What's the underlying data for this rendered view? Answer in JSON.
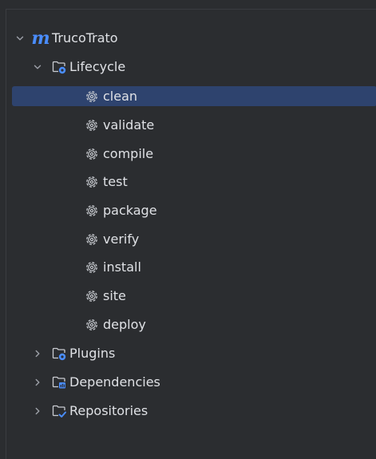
{
  "project": {
    "name": "TrucoTrato",
    "icon": "maven-m-icon",
    "logo_text": "m"
  },
  "lifecycle": {
    "label": "Lifecycle",
    "expanded": true,
    "goals": [
      "clean",
      "validate",
      "compile",
      "test",
      "package",
      "verify",
      "install",
      "site",
      "deploy"
    ],
    "selected": "clean"
  },
  "groups": [
    {
      "label": "Plugins",
      "icon": "plugins-folder-icon"
    },
    {
      "label": "Dependencies",
      "icon": "dependencies-folder-icon"
    },
    {
      "label": "Repositories",
      "icon": "repositories-folder-icon"
    }
  ],
  "colors": {
    "background": "#2b2d30",
    "selection": "#2e436e",
    "text": "#dfe1e5",
    "icon_gray": "#c9ccd1",
    "accent_blue": "#4a8dff"
  }
}
